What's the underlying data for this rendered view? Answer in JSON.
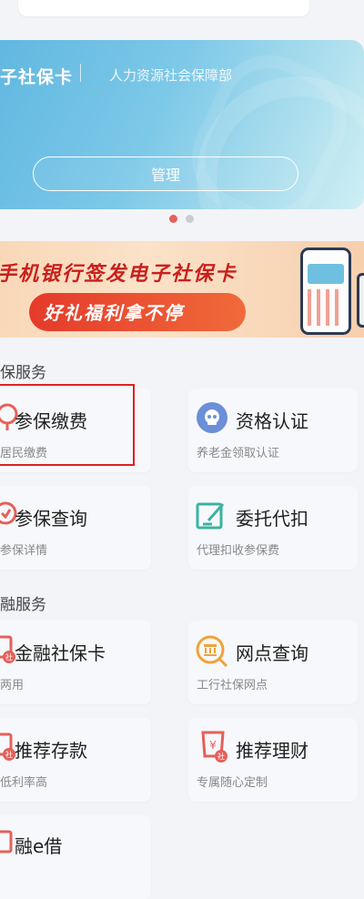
{
  "card": {
    "title": "子社保卡",
    "subtitle": "人力资源社会保障部",
    "manage_label": "管理"
  },
  "promo": {
    "line1": "手机银行签发电子社保卡",
    "line2": "好礼福利拿不停"
  },
  "sections": [
    {
      "title": "保服务",
      "tiles": [
        {
          "title": "参保缴费",
          "sub": "居民缴费",
          "icon": "payment-icon"
        },
        {
          "title": "资格认证",
          "sub": "养老金领取认证",
          "icon": "face-verify-icon"
        },
        {
          "title": "参保查询",
          "sub": "参保详情",
          "icon": "insurance-query-icon"
        },
        {
          "title": "委托代扣",
          "sub": "代理扣收参保费",
          "icon": "edit-authorize-icon"
        }
      ]
    },
    {
      "title": "融服务",
      "tiles": [
        {
          "title": "金融社保卡",
          "sub": "两用",
          "icon": "social-card-icon"
        },
        {
          "title": "网点查询",
          "sub": "工行社保网点",
          "icon": "branch-search-icon"
        },
        {
          "title": "推荐存款",
          "sub": "低利率高",
          "icon": "deposit-icon"
        },
        {
          "title": "推荐理财",
          "sub": "专属随心定制",
          "icon": "wealth-icon"
        },
        {
          "title": "融e借",
          "sub": "",
          "icon": "loan-icon"
        }
      ]
    }
  ],
  "colors": {
    "accent_red": "#e5605a",
    "card_blue": "#5fb6e0",
    "highlight_red": "#e02020"
  }
}
